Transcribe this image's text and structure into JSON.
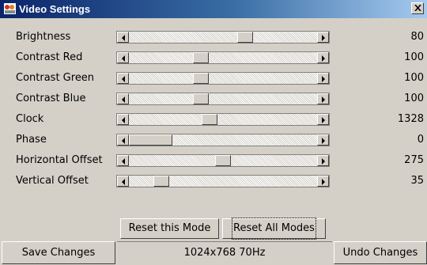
{
  "window": {
    "title": "Video Settings"
  },
  "sliders": [
    {
      "label": "Brightness",
      "value": "80",
      "position": 0.63
    },
    {
      "label": "Contrast Red",
      "value": "100",
      "position": 0.37
    },
    {
      "label": "Contrast Green",
      "value": "100",
      "position": 0.37
    },
    {
      "label": "Contrast Blue",
      "value": "100",
      "position": 0.37
    },
    {
      "label": "Clock",
      "value": "1328",
      "position": 0.42
    },
    {
      "label": "Phase",
      "value": "0",
      "position": 0.0
    },
    {
      "label": "Horizontal Offset",
      "value": "275",
      "position": 0.5
    },
    {
      "label": "Vertical Offset",
      "value": "35",
      "position": 0.14
    }
  ],
  "buttons": {
    "reset_mode": "Reset this Mode",
    "reset_all": "Reset All Modes",
    "save": "Save Changes",
    "undo": "Undo Changes"
  },
  "status": {
    "mode": "1024x768 70Hz"
  },
  "icons": {
    "app": "video-settings-icon",
    "close": "close-icon",
    "left": "left-arrow-icon",
    "right": "right-arrow-icon"
  }
}
